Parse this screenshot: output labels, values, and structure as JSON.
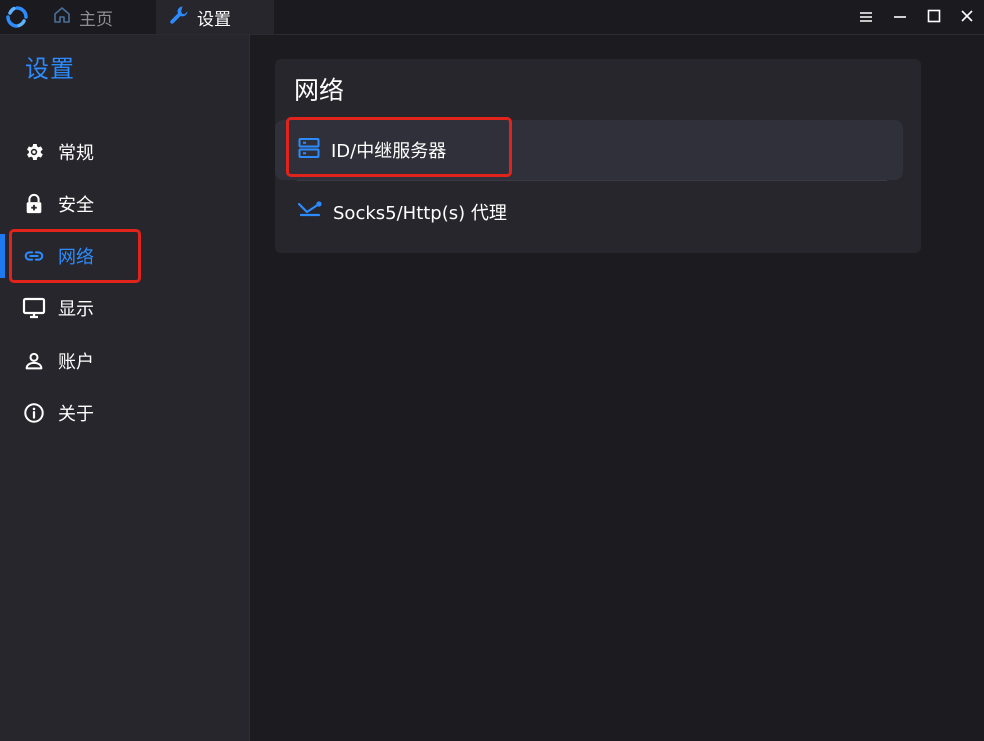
{
  "titlebar": {
    "tabs": [
      {
        "label": "主页",
        "icon": "home-icon"
      },
      {
        "label": "设置",
        "icon": "wrench-icon"
      }
    ],
    "controls": [
      "menu-icon",
      "minimize-icon",
      "maximize-icon",
      "close-icon"
    ]
  },
  "sidebar": {
    "title": "设置",
    "items": [
      {
        "label": "常规",
        "icon": "gear-icon"
      },
      {
        "label": "安全",
        "icon": "lock-icon"
      },
      {
        "label": "网络",
        "icon": "link-icon",
        "active": true
      },
      {
        "label": "显示",
        "icon": "monitor-icon"
      },
      {
        "label": "账户",
        "icon": "person-icon"
      },
      {
        "label": "关于",
        "icon": "info-icon"
      }
    ]
  },
  "main": {
    "section_title": "网络",
    "options": [
      {
        "label": "ID/中继服务器",
        "icon": "server-icon"
      },
      {
        "label": "Socks5/Http(s) 代理",
        "icon": "proxy-icon"
      }
    ]
  },
  "colors": {
    "accent": "#2c8cff",
    "highlight": "#e0241b",
    "background": "#1b1b20",
    "panel": "#26262c"
  }
}
